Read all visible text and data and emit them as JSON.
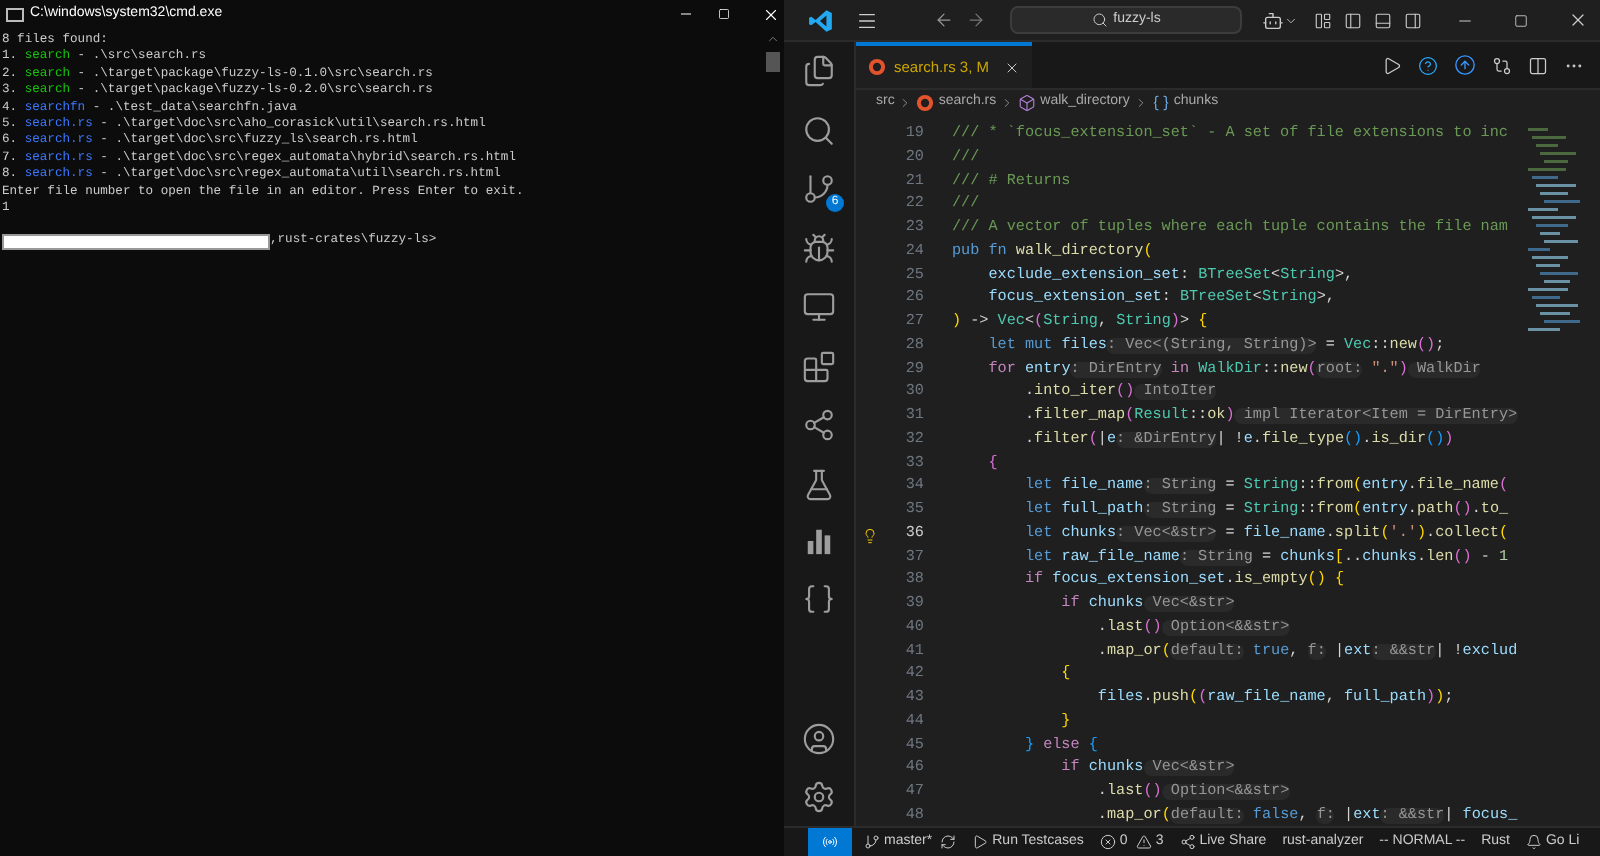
{
  "terminal": {
    "title": "C:\\windows\\system32\\cmd.exe",
    "lines": [
      {
        "kind": "plain",
        "text": "8 files found:"
      },
      {
        "kind": "result",
        "number": "1.",
        "name": "search",
        "color": "#16c60c",
        "path": " - .\\src\\search.rs"
      },
      {
        "kind": "result",
        "number": "2.",
        "name": "search",
        "color": "#16c60c",
        "path": " - .\\target\\package\\fuzzy-ls-0.1.0\\src\\search.rs"
      },
      {
        "kind": "result",
        "number": "3.",
        "name": "search",
        "color": "#16c60c",
        "path": " - .\\target\\package\\fuzzy-ls-0.2.0\\src\\search.rs"
      },
      {
        "kind": "result",
        "number": "4.",
        "name": "searchfn",
        "color": "#3b78ff",
        "path": " - .\\test_data\\searchfn.java"
      },
      {
        "kind": "result",
        "number": "5.",
        "name": "search.rs",
        "color": "#3b78ff",
        "path": " - .\\target\\doc\\src\\aho_corasick\\util\\search.rs.html"
      },
      {
        "kind": "result",
        "number": "6.",
        "name": "search.rs",
        "color": "#3b78ff",
        "path": " - .\\target\\doc\\src\\fuzzy_ls\\search.rs.html"
      },
      {
        "kind": "result",
        "number": "7.",
        "name": "search.rs",
        "color": "#3b78ff",
        "path": " - .\\target\\doc\\src\\regex_automata\\hybrid\\search.rs.html"
      },
      {
        "kind": "result",
        "number": "8.",
        "name": "search.rs",
        "color": "#3b78ff",
        "path": " - .\\target\\doc\\src\\regex_automata\\util\\search.rs.html"
      },
      {
        "kind": "plain",
        "text": "Enter file number to open the file in an editor. Press Enter to exit."
      },
      {
        "kind": "plain",
        "text": "1"
      }
    ],
    "prompt": ",rust-crates\\fuzzy-ls>"
  },
  "vscode": {
    "search": "fuzzy-ls",
    "source_control_badge": "6",
    "tab": {
      "label": "search.rs 3, M",
      "selected": true
    },
    "breadcrumbs": [
      {
        "kind": "folder",
        "label": "src"
      },
      {
        "kind": "file",
        "label": "search.rs"
      },
      {
        "kind": "function",
        "label": "walk_directory"
      },
      {
        "kind": "variable",
        "label": "chunks"
      }
    ],
    "code": [
      {
        "number": "19",
        "current": false,
        "tokens": [
          {
            "kind": "c",
            "text": "/// * `focus_extension_set` - A set of file extensions to inc"
          }
        ]
      },
      {
        "number": "20",
        "current": false,
        "tokens": [
          {
            "kind": "c",
            "text": "///"
          }
        ]
      },
      {
        "number": "21",
        "current": false,
        "tokens": [
          {
            "kind": "c",
            "text": "/// # Returns"
          }
        ]
      },
      {
        "number": "22",
        "current": false,
        "tokens": [
          {
            "kind": "c",
            "text": "///"
          }
        ]
      },
      {
        "number": "23",
        "current": false,
        "tokens": [
          {
            "kind": "c",
            "text": "/// A vector of tuples where each tuple contains the file nam"
          }
        ]
      },
      {
        "number": "24",
        "current": false,
        "tokens": [
          {
            "kind": "k",
            "text": "pub fn "
          },
          {
            "kind": "f",
            "text": "walk_directory"
          },
          {
            "kind": "y",
            "text": "("
          }
        ]
      },
      {
        "number": "25",
        "current": false,
        "tokens": [
          {
            "kind": "v",
            "text": "    exclude_extension_set"
          },
          {
            "kind": "p",
            "text": ": "
          },
          {
            "kind": "t",
            "text": "BTreeSet"
          },
          {
            "kind": "p",
            "text": "<"
          },
          {
            "kind": "t",
            "text": "String"
          },
          {
            "kind": "p",
            "text": ">,"
          }
        ]
      },
      {
        "number": "26",
        "current": false,
        "tokens": [
          {
            "kind": "v",
            "text": "    focus_extension_set"
          },
          {
            "kind": "p",
            "text": ": "
          },
          {
            "kind": "t",
            "text": "BTreeSet"
          },
          {
            "kind": "p",
            "text": "<"
          },
          {
            "kind": "t",
            "text": "String"
          },
          {
            "kind": "p",
            "text": ">,"
          }
        ]
      },
      {
        "number": "27",
        "current": false,
        "tokens": [
          {
            "kind": "y",
            "text": ")"
          },
          {
            "kind": "p",
            "text": " -> "
          },
          {
            "kind": "t",
            "text": "Vec"
          },
          {
            "kind": "p",
            "text": "<"
          },
          {
            "kind": "m",
            "text": "("
          },
          {
            "kind": "t",
            "text": "String"
          },
          {
            "kind": "p",
            "text": ", "
          },
          {
            "kind": "t",
            "text": "String"
          },
          {
            "kind": "m",
            "text": ")"
          },
          {
            "kind": "p",
            "text": ">"
          },
          {
            "kind": "y",
            "text": " {"
          }
        ]
      },
      {
        "number": "28",
        "current": false,
        "tokens": [
          {
            "kind": "k",
            "text": "    let mut "
          },
          {
            "kind": "v",
            "text": "files"
          },
          {
            "kind": "h",
            "text": ": Vec<(String, String)>"
          },
          {
            "kind": "p",
            "text": " = "
          },
          {
            "kind": "t",
            "text": "Vec"
          },
          {
            "kind": "p",
            "text": "::"
          },
          {
            "kind": "f",
            "text": "new"
          },
          {
            "kind": "m",
            "text": "()"
          },
          {
            "kind": "p",
            "text": ";"
          }
        ]
      },
      {
        "number": "29",
        "current": false,
        "tokens": [
          {
            "kind": "q",
            "text": "    for "
          },
          {
            "kind": "v",
            "text": "entry"
          },
          {
            "kind": "h",
            "text": ": DirEntry"
          },
          {
            "kind": "q",
            "text": " in "
          },
          {
            "kind": "t",
            "text": "WalkDir"
          },
          {
            "kind": "p",
            "text": "::"
          },
          {
            "kind": "f",
            "text": "new"
          },
          {
            "kind": "m",
            "text": "("
          },
          {
            "kind": "h",
            "text": "root:"
          },
          {
            "kind": "s",
            "text": " \".\""
          },
          {
            "kind": "m",
            "text": ")"
          },
          {
            "kind": "h",
            "text": " WalkDir"
          }
        ]
      },
      {
        "number": "30",
        "current": false,
        "tokens": [
          {
            "kind": "p",
            "text": "        ."
          },
          {
            "kind": "f",
            "text": "into_iter"
          },
          {
            "kind": "m",
            "text": "()"
          },
          {
            "kind": "h",
            "text": " IntoIter"
          }
        ]
      },
      {
        "number": "31",
        "current": false,
        "tokens": [
          {
            "kind": "p",
            "text": "        ."
          },
          {
            "kind": "f",
            "text": "filter_map"
          },
          {
            "kind": "m",
            "text": "("
          },
          {
            "kind": "t",
            "text": "Result"
          },
          {
            "kind": "p",
            "text": "::"
          },
          {
            "kind": "f",
            "text": "ok"
          },
          {
            "kind": "m",
            "text": ")"
          },
          {
            "kind": "h",
            "text": " impl Iterator<Item = DirEntry>"
          }
        ]
      },
      {
        "number": "32",
        "current": false,
        "tokens": [
          {
            "kind": "p",
            "text": "        ."
          },
          {
            "kind": "f",
            "text": "filter"
          },
          {
            "kind": "m",
            "text": "("
          },
          {
            "kind": "p",
            "text": "|"
          },
          {
            "kind": "v",
            "text": "e"
          },
          {
            "kind": "h",
            "text": ": &DirEntry"
          },
          {
            "kind": "p",
            "text": "| !"
          },
          {
            "kind": "v",
            "text": "e"
          },
          {
            "kind": "p",
            "text": "."
          },
          {
            "kind": "f",
            "text": "file_type"
          },
          {
            "kind": "b",
            "text": "()"
          },
          {
            "kind": "p",
            "text": "."
          },
          {
            "kind": "f",
            "text": "is_dir"
          },
          {
            "kind": "b",
            "text": "()"
          },
          {
            "kind": "m",
            "text": ")"
          }
        ]
      },
      {
        "number": "33",
        "current": false,
        "tokens": [
          {
            "kind": "m",
            "text": "    {"
          }
        ]
      },
      {
        "number": "34",
        "current": false,
        "tokens": [
          {
            "kind": "k",
            "text": "        let "
          },
          {
            "kind": "v",
            "text": "file_name"
          },
          {
            "kind": "h",
            "text": ": String"
          },
          {
            "kind": "p",
            "text": " = "
          },
          {
            "kind": "t",
            "text": "String"
          },
          {
            "kind": "p",
            "text": "::"
          },
          {
            "kind": "f",
            "text": "from"
          },
          {
            "kind": "y",
            "text": "("
          },
          {
            "kind": "v",
            "text": "entry"
          },
          {
            "kind": "p",
            "text": "."
          },
          {
            "kind": "f",
            "text": "file_name"
          },
          {
            "kind": "m",
            "text": "("
          }
        ]
      },
      {
        "number": "35",
        "current": false,
        "tokens": [
          {
            "kind": "k",
            "text": "        let "
          },
          {
            "kind": "v",
            "text": "full_path"
          },
          {
            "kind": "h",
            "text": ": String"
          },
          {
            "kind": "p",
            "text": " = "
          },
          {
            "kind": "t",
            "text": "String"
          },
          {
            "kind": "p",
            "text": "::"
          },
          {
            "kind": "f",
            "text": "from"
          },
          {
            "kind": "y",
            "text": "("
          },
          {
            "kind": "v",
            "text": "entry"
          },
          {
            "kind": "p",
            "text": "."
          },
          {
            "kind": "f",
            "text": "path"
          },
          {
            "kind": "m",
            "text": "()"
          },
          {
            "kind": "p",
            "text": "."
          },
          {
            "kind": "f",
            "text": "to_"
          }
        ]
      },
      {
        "number": "36",
        "current": true,
        "tokens": [
          {
            "kind": "k",
            "text": "        let "
          },
          {
            "kind": "v",
            "text": "chunks"
          },
          {
            "kind": "h",
            "text": ": Vec<&str>"
          },
          {
            "kind": "p",
            "text": " = "
          },
          {
            "kind": "v",
            "text": "file_name"
          },
          {
            "kind": "p",
            "text": "."
          },
          {
            "kind": "f",
            "text": "split"
          },
          {
            "kind": "y",
            "text": "("
          },
          {
            "kind": "s",
            "text": "'.'"
          },
          {
            "kind": "y",
            "text": ")"
          },
          {
            "kind": "p",
            "text": "."
          },
          {
            "kind": "f",
            "text": "collect"
          },
          {
            "kind": "y",
            "text": "("
          }
        ]
      },
      {
        "number": "37",
        "current": false,
        "tokens": [
          {
            "kind": "k",
            "text": "        let "
          },
          {
            "kind": "v",
            "text": "raw_file_name"
          },
          {
            "kind": "h",
            "text": ": String"
          },
          {
            "kind": "p",
            "text": " = "
          },
          {
            "kind": "v",
            "text": "chunks"
          },
          {
            "kind": "y",
            "text": "["
          },
          {
            "kind": "p",
            "text": ".."
          },
          {
            "kind": "v",
            "text": "chunks"
          },
          {
            "kind": "p",
            "text": "."
          },
          {
            "kind": "f",
            "text": "len"
          },
          {
            "kind": "m",
            "text": "()"
          },
          {
            "kind": "p",
            "text": " - "
          },
          {
            "kind": "n",
            "text": "1"
          }
        ]
      },
      {
        "number": "38",
        "current": false,
        "tokens": [
          {
            "kind": "q",
            "text": "        if "
          },
          {
            "kind": "v",
            "text": "focus_extension_set"
          },
          {
            "kind": "p",
            "text": "."
          },
          {
            "kind": "f",
            "text": "is_empty"
          },
          {
            "kind": "y",
            "text": "()"
          },
          {
            "kind": "y",
            "text": " {"
          }
        ]
      },
      {
        "number": "39",
        "current": false,
        "tokens": [
          {
            "kind": "q",
            "text": "            if "
          },
          {
            "kind": "v",
            "text": "chunks"
          },
          {
            "kind": "h",
            "text": " Vec<&str>"
          }
        ]
      },
      {
        "number": "40",
        "current": false,
        "tokens": [
          {
            "kind": "p",
            "text": "                ."
          },
          {
            "kind": "f",
            "text": "last"
          },
          {
            "kind": "m",
            "text": "()"
          },
          {
            "kind": "h",
            "text": " Option<&&str>"
          }
        ]
      },
      {
        "number": "41",
        "current": false,
        "tokens": [
          {
            "kind": "p",
            "text": "                ."
          },
          {
            "kind": "f",
            "text": "map_or"
          },
          {
            "kind": "y",
            "text": "("
          },
          {
            "kind": "h",
            "text": "default:"
          },
          {
            "kind": "k",
            "text": " true"
          },
          {
            "kind": "p",
            "text": ", "
          },
          {
            "kind": "h",
            "text": "f:"
          },
          {
            "kind": "p",
            "text": " |"
          },
          {
            "kind": "v",
            "text": "ext"
          },
          {
            "kind": "h",
            "text": ": &&str"
          },
          {
            "kind": "p",
            "text": "| !"
          },
          {
            "kind": "v",
            "text": "exclud"
          }
        ]
      },
      {
        "number": "42",
        "current": false,
        "tokens": [
          {
            "kind": "y",
            "text": "            {"
          }
        ]
      },
      {
        "number": "43",
        "current": false,
        "tokens": [
          {
            "kind": "v",
            "text": "                files"
          },
          {
            "kind": "p",
            "text": "."
          },
          {
            "kind": "f",
            "text": "push"
          },
          {
            "kind": "y",
            "text": "("
          },
          {
            "kind": "m",
            "text": "("
          },
          {
            "kind": "v",
            "text": "raw_file_name"
          },
          {
            "kind": "p",
            "text": ", "
          },
          {
            "kind": "v",
            "text": "full_path"
          },
          {
            "kind": "m",
            "text": ")"
          },
          {
            "kind": "y",
            "text": ")"
          },
          {
            "kind": "p",
            "text": ";"
          }
        ]
      },
      {
        "number": "44",
        "current": false,
        "tokens": [
          {
            "kind": "y",
            "text": "            }"
          }
        ]
      },
      {
        "number": "45",
        "current": false,
        "tokens": [
          {
            "kind": "b",
            "text": "        }"
          },
          {
            "kind": "q",
            "text": " else"
          },
          {
            "kind": "b",
            "text": " {"
          }
        ]
      },
      {
        "number": "46",
        "current": false,
        "tokens": [
          {
            "kind": "q",
            "text": "            if "
          },
          {
            "kind": "v",
            "text": "chunks"
          },
          {
            "kind": "h",
            "text": " Vec<&str>"
          }
        ]
      },
      {
        "number": "47",
        "current": false,
        "tokens": [
          {
            "kind": "p",
            "text": "                ."
          },
          {
            "kind": "f",
            "text": "last"
          },
          {
            "kind": "m",
            "text": "()"
          },
          {
            "kind": "h",
            "text": " Option<&&str>"
          }
        ]
      },
      {
        "number": "48",
        "current": false,
        "tokens": [
          {
            "kind": "p",
            "text": "                ."
          },
          {
            "kind": "f",
            "text": "map_or"
          },
          {
            "kind": "y",
            "text": "("
          },
          {
            "kind": "h",
            "text": "default:"
          },
          {
            "kind": "k",
            "text": " false"
          },
          {
            "kind": "p",
            "text": ", "
          },
          {
            "kind": "h",
            "text": "f:"
          },
          {
            "kind": "p",
            "text": " |"
          },
          {
            "kind": "v",
            "text": "ext"
          },
          {
            "kind": "h",
            "text": ": &&str"
          },
          {
            "kind": "p",
            "text": "| "
          },
          {
            "kind": "v",
            "text": "focus_"
          }
        ]
      }
    ],
    "status_bar": {
      "branch": "master*",
      "run": "Run Testcases",
      "errors": "0",
      "warnings": "3",
      "live_share": "Live Share",
      "analyzer": "rust-analyzer",
      "mode": "-- NORMAL --",
      "language": "Rust",
      "go_live": "Go Li"
    }
  }
}
